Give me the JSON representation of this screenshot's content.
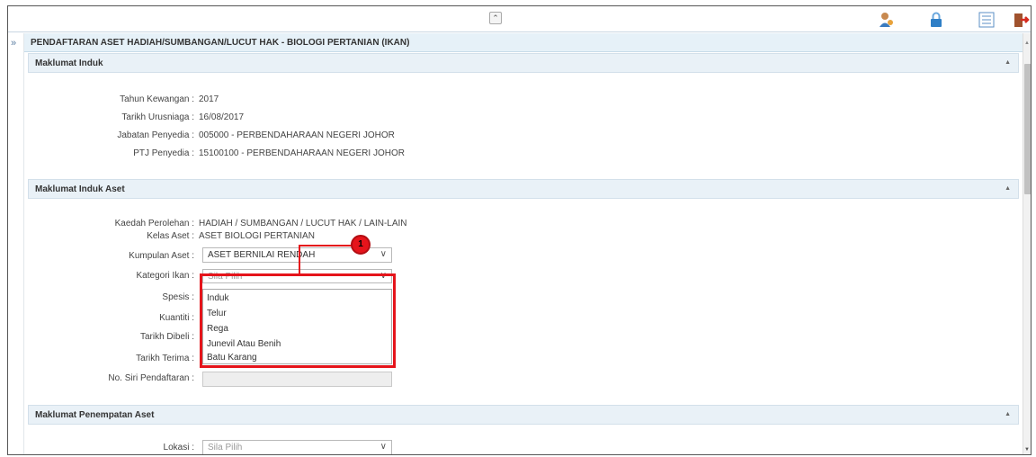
{
  "toolbar": {
    "collapse_glyph": "⌃",
    "icons": [
      "user-icon",
      "lock-icon",
      "list-icon",
      "exit-icon"
    ]
  },
  "page": {
    "nav_glyph": "»",
    "title": "PENDAFTARAN ASET HADIAH/SUMBANGAN/LUCUT HAK - BIOLOGI PERTANIAN (IKAN)"
  },
  "maklumat_induk": {
    "heading": "Maklumat Induk",
    "fields": [
      {
        "label": "Tahun Kewangan :",
        "value": "2017"
      },
      {
        "label": "Tarikh Urusniaga :",
        "value": "16/08/2017"
      },
      {
        "label": "Jabatan Penyedia :",
        "value": "005000 - PERBENDAHARAAN NEGERI JOHOR"
      },
      {
        "label": "PTJ Penyedia :",
        "value": "15100100 - PERBENDAHARAAN NEGERI JOHOR"
      }
    ]
  },
  "maklumat_induk_aset": {
    "heading": "Maklumat Induk Aset",
    "kaedah_label": "Kaedah Perolehan :",
    "kaedah_value": "HADIAH / SUMBANGAN / LUCUT HAK / LAIN-LAIN",
    "kelas_label": "Kelas Aset :",
    "kelas_value": "ASET BIOLOGI PERTANIAN",
    "kumpulan_label": "Kumpulan Aset :",
    "kumpulan_value": "ASET BERNILAI RENDAH",
    "kategori_label": "Kategori Ikan :",
    "kategori_placeholder": "Sila Pilih",
    "kategori_options": [
      "Induk",
      "Telur",
      "Rega",
      "Junevil Atau Benih",
      "Batu Karang"
    ],
    "spesis_label": "Spesis :",
    "kuantiti_label": "Kuantiti :",
    "tarikh_dibeli_label": "Tarikh Dibeli :",
    "tarikh_terima_label": "Tarikh Terima :",
    "no_siri_label": "No. Siri Pendaftaran :"
  },
  "maklumat_penempatan": {
    "heading": "Maklumat Penempatan Aset",
    "lokasi_label": "Lokasi :",
    "lokasi_placeholder": "Sila Pilih"
  },
  "annotation": {
    "number": "1",
    "color": "#e5141b"
  },
  "dropdown_glyph": "∨",
  "section_caret": "▲"
}
